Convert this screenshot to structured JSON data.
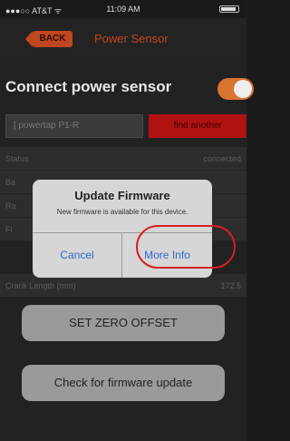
{
  "status_bar": {
    "carrier": "●●●○○ AT&T ᯤ",
    "time": "11:09 AM"
  },
  "nav": {
    "back_label": "BACK",
    "title": "Power Sensor"
  },
  "connect": {
    "label": "Connect power sensor",
    "enabled": true
  },
  "device": {
    "name": "[ powertap P1-R",
    "find_label": "find another"
  },
  "rows": [
    {
      "label": "Status",
      "value": "connected"
    },
    {
      "label": "Ba",
      "value": ""
    },
    {
      "label": "Ra",
      "value": ""
    },
    {
      "label": "Fi",
      "value": ""
    },
    {
      "label": "Crank Length (mm)",
      "value": "172.5"
    }
  ],
  "dialog": {
    "title": "Update Firmware",
    "message": "New firmware is available for this device.",
    "cancel_label": "Cancel",
    "more_info_label": "More Info"
  },
  "buttons": {
    "zero_offset_label": "SET ZERO OFFSET",
    "firmware_check_label": "Check for firmware update"
  },
  "colors": {
    "accent": "#c0461f",
    "alert_red": "#b01212",
    "ios_blue": "#2f6ad0",
    "highlight": "#d4202a"
  }
}
